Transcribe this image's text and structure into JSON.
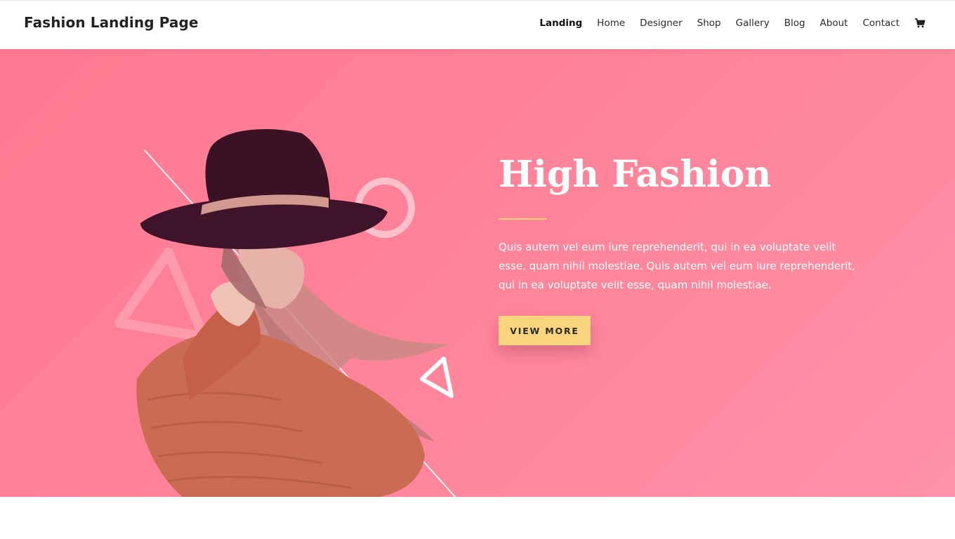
{
  "header": {
    "site_title": "Fashion Landing Page",
    "nav": [
      {
        "label": "Landing",
        "active": true
      },
      {
        "label": "Home"
      },
      {
        "label": "Designer"
      },
      {
        "label": "Shop"
      },
      {
        "label": "Gallery"
      },
      {
        "label": "Blog"
      },
      {
        "label": "About"
      },
      {
        "label": "Contact"
      }
    ],
    "cart_icon": "shopping-cart-icon"
  },
  "hero": {
    "title": "High Fashion",
    "body": "Quis autem vel eum iure reprehenderit, qui in ea voluptate velit esse, quam nihil molestiae. Quis autem vel eum iure reprehenderit, qui in ea voluptate velit esse, quam nihil molestiae.",
    "button_label": "View More",
    "image_subject": "woman in wide-brim hat and knit sweater",
    "decorations": [
      "ring-shape",
      "triangle-outline",
      "small-triangle-outline",
      "diagonal-line"
    ]
  },
  "colors": {
    "hero_bg": "#ff8298",
    "accent_gold": "#f9d47e",
    "hat": "#3a1224",
    "sweater": "#c86d55",
    "text_dark": "#222222"
  }
}
